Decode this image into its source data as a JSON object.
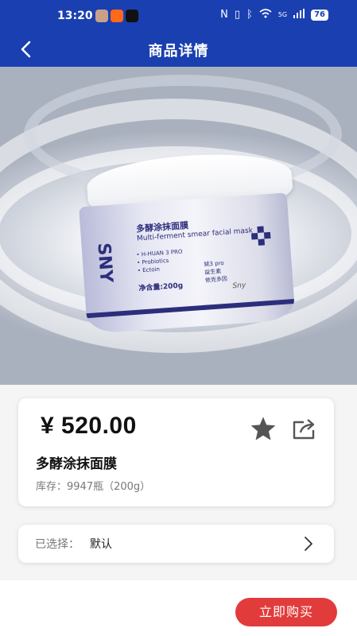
{
  "status_bar": {
    "time": "13:20",
    "network": "5G",
    "battery": "76",
    "icons": [
      "nfc-icon",
      "vibrate-icon",
      "bluetooth-icon",
      "wifi-icon",
      "signal-icon",
      "battery-icon"
    ]
  },
  "nav": {
    "title": "商品详情",
    "back_icon": "chevron-left-icon"
  },
  "product_image": {
    "brand": "SNY",
    "name_cn": "多酵涂抹面膜",
    "name_en": "Multi-ferment smear facial mask",
    "ingredients": [
      "• H-HUAN 3 PRO",
      "• Probiotics",
      "• Ectoin"
    ],
    "ingredients_cn": [
      "姚3 pro",
      "益生素",
      "依克多因"
    ],
    "net_weight": "净含量:200g"
  },
  "product": {
    "price": "¥ 520.00",
    "name": "多酵涂抹面膜",
    "stock": "库存：9947瓶（200g）",
    "actions": [
      "star-icon",
      "share-icon"
    ]
  },
  "selection": {
    "label": "已选择：",
    "value": "默认"
  },
  "bottom": {
    "buy_label": "立即购买"
  },
  "colors": {
    "brand_blue": "#1a3fb0",
    "buy_red": "#e23b3b"
  }
}
